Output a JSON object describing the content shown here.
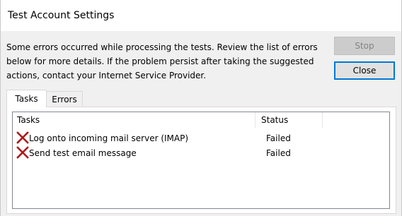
{
  "window": {
    "title": "Test Account Settings"
  },
  "message": "Some errors occurred while processing the tests. Review the list of errors below for more details. If the problem persist after taking the suggested actions, contact your Internet Service Provider.",
  "buttons": {
    "stop_label": "Stop",
    "stop_enabled": false,
    "close_label": "Close"
  },
  "tabs": [
    {
      "label": "Tasks",
      "selected": true
    },
    {
      "label": "Errors",
      "selected": false
    }
  ],
  "task_list": {
    "columns": [
      "Tasks",
      "Status"
    ],
    "rows": [
      {
        "icon": "failed-x-icon",
        "task": "Log onto incoming mail server (IMAP)",
        "status": "Failed"
      },
      {
        "icon": "failed-x-icon",
        "task": "Send test email message",
        "status": "Failed"
      }
    ]
  },
  "colors": {
    "focus_border": "#0078d7",
    "failed_icon": "#b01818",
    "dialog_background": "#f0f0f0"
  }
}
